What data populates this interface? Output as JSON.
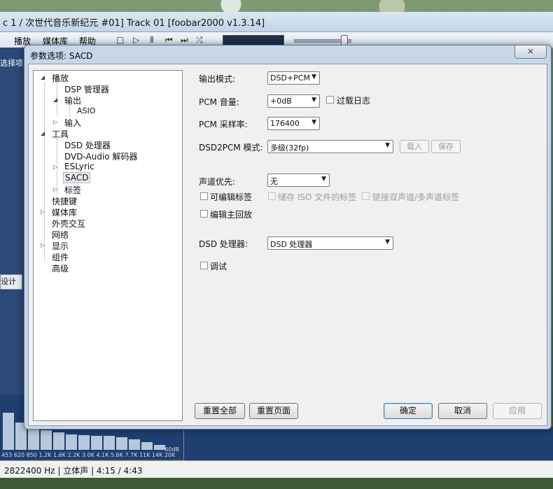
{
  "background_app": {
    "window_title": "c 1 / 次世代音乐新纪元 #01] Track 01   [foobar2000 v1.3.14]",
    "menu": [
      "播放",
      "媒体库",
      "帮助"
    ],
    "left_label": "选择项",
    "tab_button": "设计",
    "visualizer": {
      "frequency_labels": "453 620 850 1.2K 1.6K 2.2K 3.0K 4.1K 5.6K 7.7K 11K 14K 20K",
      "db_label": "-60dB",
      "bar_levels": [
        0.75,
        0.55,
        0.45,
        0.4,
        0.35,
        0.32,
        0.3,
        0.28,
        0.28,
        0.25,
        0.22,
        0.16,
        0.1
      ]
    },
    "status_text": "2822400 Hz | 立体声 | 4:15 / 4:43"
  },
  "dialog": {
    "title": "参数选项: SACD",
    "close_symbol": "⨯",
    "tree": [
      {
        "label": "播放",
        "expanded": true
      },
      {
        "label": "DSP 管理器"
      },
      {
        "label": "输出",
        "expanded": true
      },
      {
        "label": "ASIO"
      },
      {
        "label": "输入",
        "expanded": false
      },
      {
        "label": "工具",
        "expanded": true
      },
      {
        "label": "DSD 处理器"
      },
      {
        "label": "DVD-Audio 解码器"
      },
      {
        "label": "ESLyric",
        "expanded": false
      },
      {
        "label": "SACD",
        "selected": true
      },
      {
        "label": "标签",
        "expanded": false
      },
      {
        "label": "快捷键"
      },
      {
        "label": "媒体库",
        "expanded": false
      },
      {
        "label": "外壳交互"
      },
      {
        "label": "网络"
      },
      {
        "label": "显示",
        "expanded": false
      },
      {
        "label": "组件"
      },
      {
        "label": "高级"
      }
    ],
    "settings": {
      "output_mode": {
        "label": "输出模式:",
        "value": "DSD+PCM"
      },
      "pcm_volume": {
        "label": "PCM 音量:",
        "value": "+0dB"
      },
      "overload_log": {
        "label": "过载日志",
        "checked": false
      },
      "pcm_samplerate": {
        "label": "PCM 采样率:",
        "value": "176400"
      },
      "dsd2pcm_mode": {
        "label": "DSD2PCM 模式:",
        "value": "多级(32fp)"
      },
      "load_button": "载入",
      "save_button": "保存",
      "channel_priority": {
        "label": "声道优先:",
        "value": "无"
      },
      "editable_tags": {
        "label": "可编辑标签",
        "checked": false
      },
      "store_iso_tags": {
        "label": "储存 ISO 文件的标签",
        "checked": false
      },
      "link_tags": {
        "label": "链接双声道/多声道标签",
        "checked": false
      },
      "edit_master": {
        "label": "编辑主回放",
        "checked": false
      },
      "dsd_processor": {
        "label": "DSD 处理器:",
        "value": "DSD 处理器"
      },
      "debug": {
        "label": "调试",
        "checked": false
      }
    },
    "buttons": {
      "reset_all": "重置全部",
      "reset_page": "重置页面",
      "ok": "确定",
      "cancel": "取消",
      "apply": "应用"
    },
    "icons": {
      "expanded": "◢",
      "collapsed": "▷",
      "dropdown": "▼"
    }
  }
}
